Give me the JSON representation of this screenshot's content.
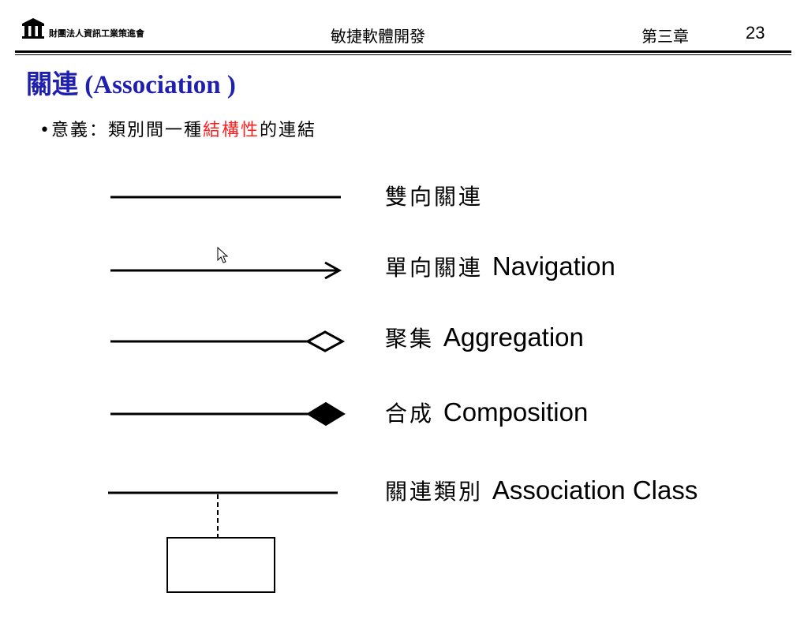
{
  "header": {
    "org_name": "財團法人資訊工業策進會",
    "course_title": "敏捷軟體開發",
    "chapter": "第三章",
    "page_number": "23"
  },
  "slide": {
    "title": "關連 (Association )",
    "bullet_prefix": "•意義：類別間一種",
    "bullet_highlight": "結構性",
    "bullet_suffix": "的連結",
    "highlight_color": "#ff2020",
    "title_color": "#1f1fb0"
  },
  "relations": [
    {
      "zh": "雙向關連",
      "en": ""
    },
    {
      "zh": "單向關連 ",
      "en": "Navigation"
    },
    {
      "zh": "聚集 ",
      "en": "Aggregation"
    },
    {
      "zh": "合成 ",
      "en": "Composition"
    },
    {
      "zh": "關連類別 ",
      "en": "Association Class"
    }
  ],
  "icons": {
    "logo": "building-columns-icon",
    "cursor": "mouse-pointer-icon"
  }
}
